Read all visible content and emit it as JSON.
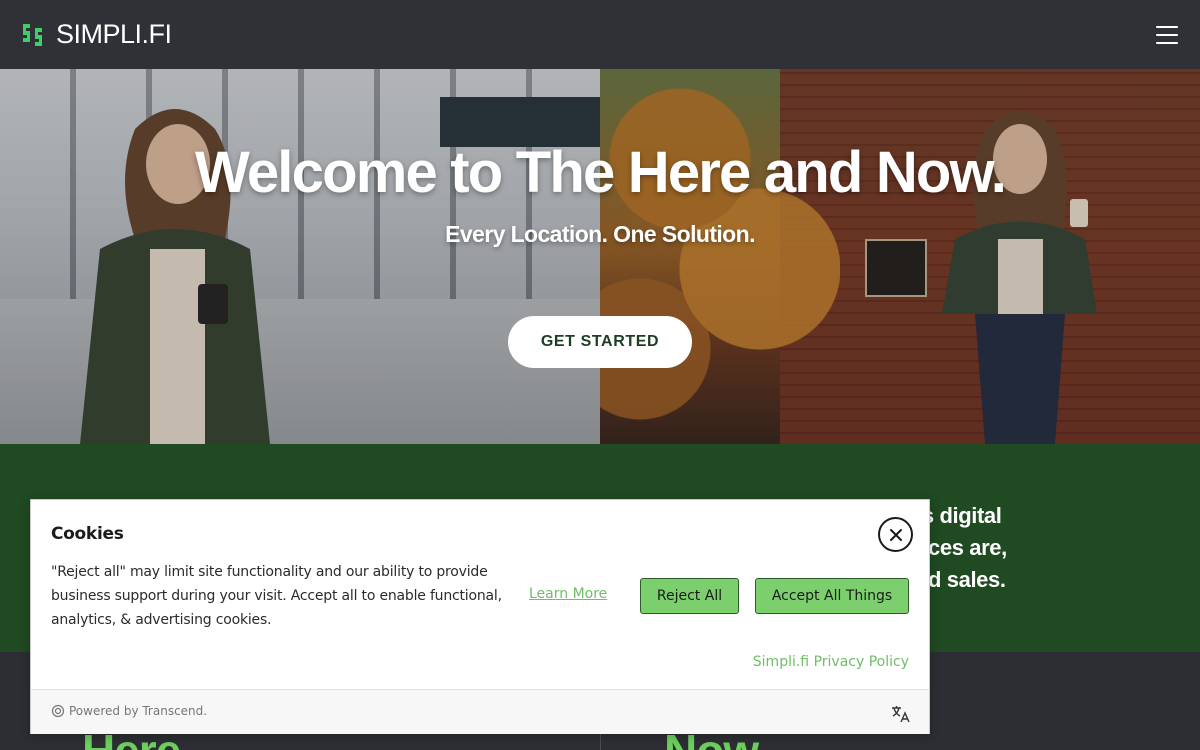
{
  "header": {
    "brand": "SIMPLI.FI",
    "logo_icon": "ss-logo-icon",
    "menu_icon": "hamburger-menu-icon",
    "brand_green": "#3ecf6a"
  },
  "hero": {
    "title": "Welcome to The Here and Now.",
    "subtitle": "Every Location. One Solution.",
    "cta_label": "GET STARTED"
  },
  "green_band": {
    "text_line1": "ts digital",
    "text_line2": "nces are,",
    "text_line3": "nd sales.",
    "color": "#1f4a22"
  },
  "bottom": {
    "left_word": "Here",
    "right_word": "Now",
    "accent": "#6ccf5e"
  },
  "cookie": {
    "title": "Cookies",
    "body": "\"Reject all\" may limit site functionality and our ability to provide business support during your visit. Accept all to enable functional, analytics, & advertising cookies.",
    "learn_more": "Learn More",
    "reject_label": "Reject All",
    "accept_label": "Accept All Things",
    "privacy_link": "Simpli.fi Privacy Policy",
    "powered_by": "Powered by Transcend.",
    "close_icon": "close-icon",
    "language_icon": "translate-icon",
    "button_color": "#7bd06d",
    "link_color": "#6fbf65"
  }
}
